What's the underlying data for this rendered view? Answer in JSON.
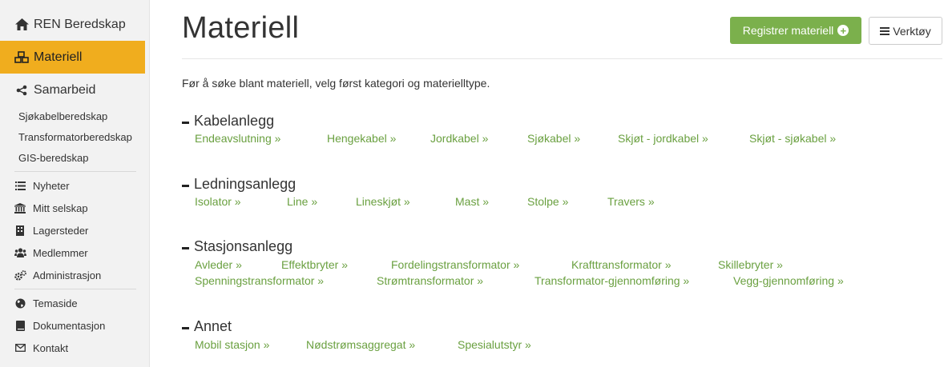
{
  "sidebar": {
    "top": [
      {
        "label": "REN Beredskap",
        "icon": "home-icon"
      },
      {
        "label": "Materiell",
        "icon": "cubes-icon",
        "active": true
      },
      {
        "label": "Samarbeid",
        "icon": "share-icon"
      }
    ],
    "sub": [
      "Sjøkabelberedskap",
      "Transformatorberedskap",
      "GIS-beredskap"
    ],
    "group1": [
      {
        "label": "Nyheter",
        "icon": "list-icon"
      },
      {
        "label": "Mitt selskap",
        "icon": "institution-icon"
      },
      {
        "label": "Lagersteder",
        "icon": "building-icon"
      },
      {
        "label": "Medlemmer",
        "icon": "users-icon"
      },
      {
        "label": "Administrasjon",
        "icon": "cogs-icon"
      }
    ],
    "group2": [
      {
        "label": "Temaside",
        "icon": "globe-icon"
      },
      {
        "label": "Dokumentasjon",
        "icon": "book-icon"
      },
      {
        "label": "Kontakt",
        "icon": "envelope-icon"
      }
    ]
  },
  "header": {
    "title": "Materiell",
    "register_label": "Registrer materiell",
    "tools_label": "Verktøy"
  },
  "intro": "Før å søke blant materiell, velg først kategori og materielltype.",
  "sections": [
    {
      "title": "Kabelanlegg",
      "links": [
        "Endeavslutning »",
        "Hengekabel »",
        "Jordkabel »",
        "Sjøkabel »",
        "Skjøt - jordkabel »",
        "Skjøt - sjøkabel »"
      ]
    },
    {
      "title": "Ledningsanlegg",
      "links": [
        "Isolator »",
        "Line »",
        "Lineskjøt »",
        "Mast »",
        "Stolpe »",
        "Travers »"
      ]
    },
    {
      "title": "Stasjonsanlegg",
      "links": [
        "Avleder »",
        "Effektbryter »",
        "Fordelingstransformator »",
        "Krafttransformator »",
        "Skillebryter »",
        "Spenningstransformator »",
        "Strømtransformator »",
        "Transformator-gjennomføring »",
        "Vegg-gjennomføring »"
      ]
    },
    {
      "title": "Annet",
      "links": [
        "Mobil stasjon »",
        "Nødstrømsaggregat »",
        "Spesialutstyr »"
      ]
    }
  ]
}
